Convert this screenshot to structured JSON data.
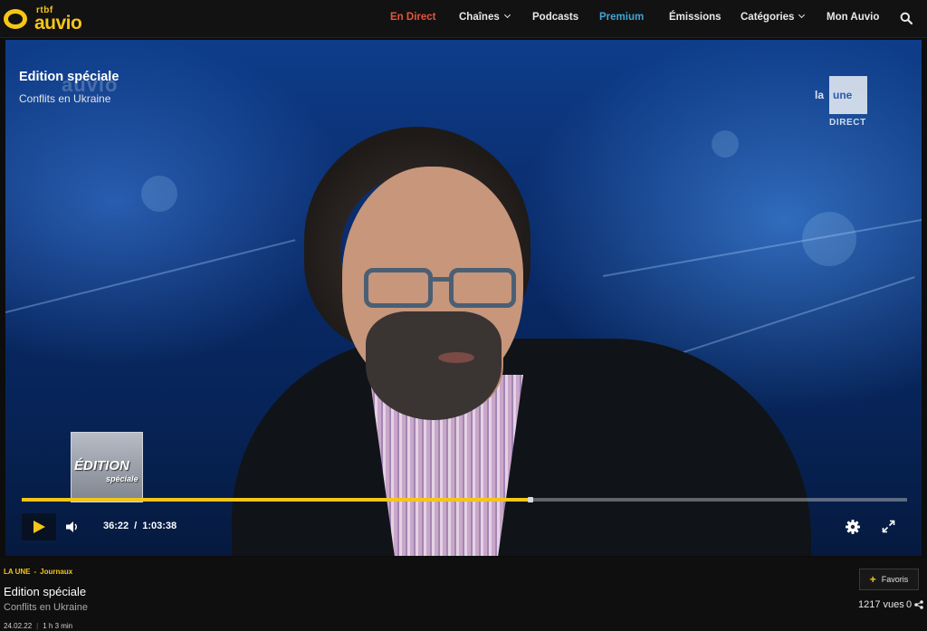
{
  "logo": {
    "top_text": "rtbf",
    "main_text": "auvio"
  },
  "nav": {
    "items": [
      {
        "label": "En Direct"
      },
      {
        "label": "Chaînes"
      },
      {
        "label": "Podcasts"
      },
      {
        "label": "Premium"
      },
      {
        "label": "Émissions"
      },
      {
        "label": "Catégories"
      },
      {
        "label": "Mon Auvio"
      }
    ],
    "search_icon": "search-icon"
  },
  "player": {
    "title": "Edition spéciale",
    "subtitle": "Conflits en Ukraine",
    "watermark": "auvio",
    "channel": {
      "prefix": "la",
      "name": "une",
      "status": "DIRECT"
    },
    "badge": {
      "line1": "ÉDITION",
      "line2": "spéciale"
    },
    "current_time": "36:22",
    "time_separator": "/",
    "duration": "1:03:38",
    "progress_fraction": 0.5716,
    "colors": {
      "progress": "#f5c518",
      "live": "#e8543a",
      "premium": "#3ea6d6"
    }
  },
  "info": {
    "channel": "LA UNE",
    "category": "Journaux",
    "title": "Edition spéciale",
    "subtitle": "Conflits en Ukraine",
    "date": "24.02.22",
    "length": "1 h 3 min",
    "favorite_label": "Favoris",
    "views": "1217 vues",
    "shares": "0"
  }
}
